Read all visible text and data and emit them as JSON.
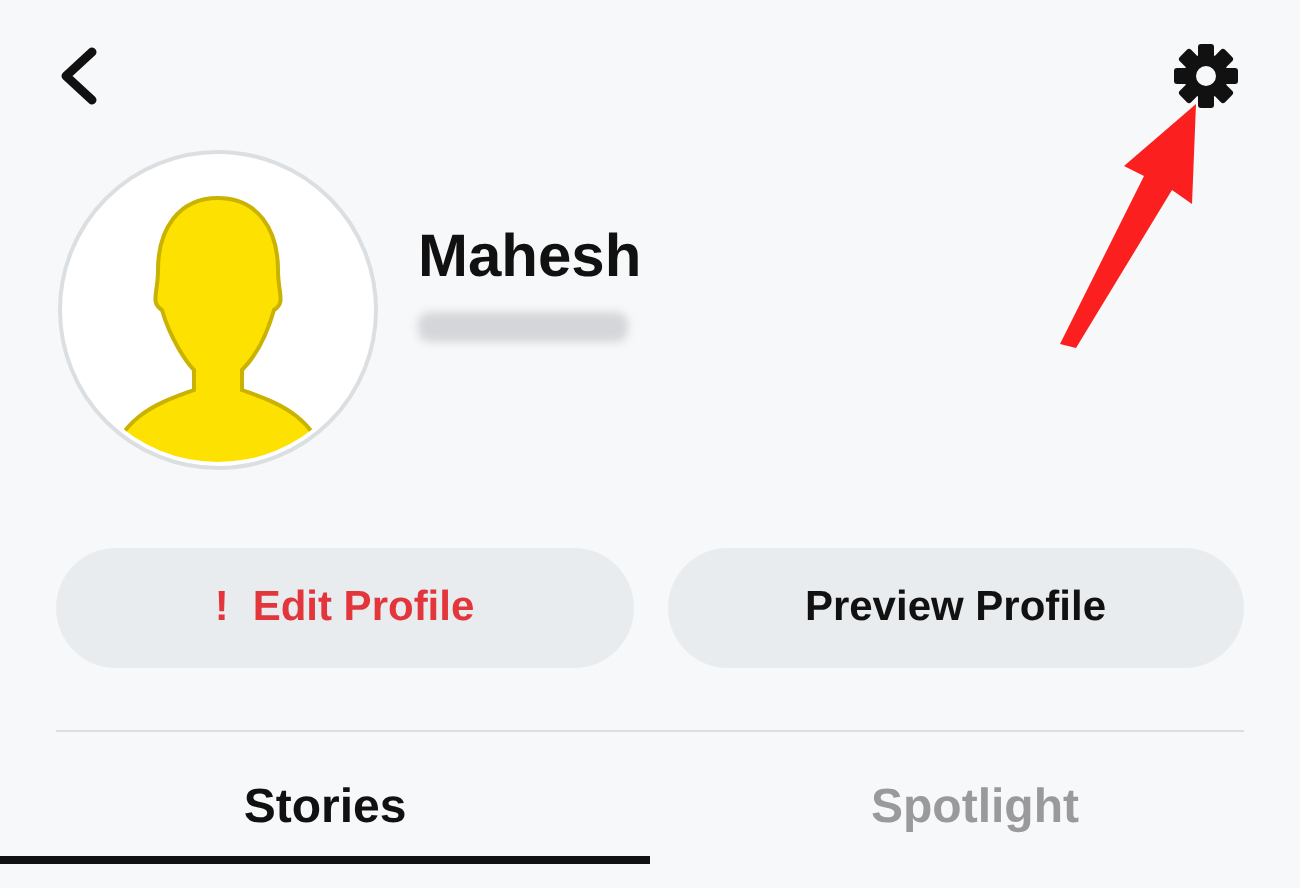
{
  "profile": {
    "name": "Mahesh"
  },
  "buttons": [
    {
      "kind": "alert",
      "icon": "!",
      "label": "Edit Profile"
    },
    {
      "kind": "plain",
      "label": "Preview Profile"
    }
  ],
  "tabs": [
    {
      "label": "Stories",
      "selected": true
    },
    {
      "label": "Spotlight",
      "selected": false
    }
  ]
}
